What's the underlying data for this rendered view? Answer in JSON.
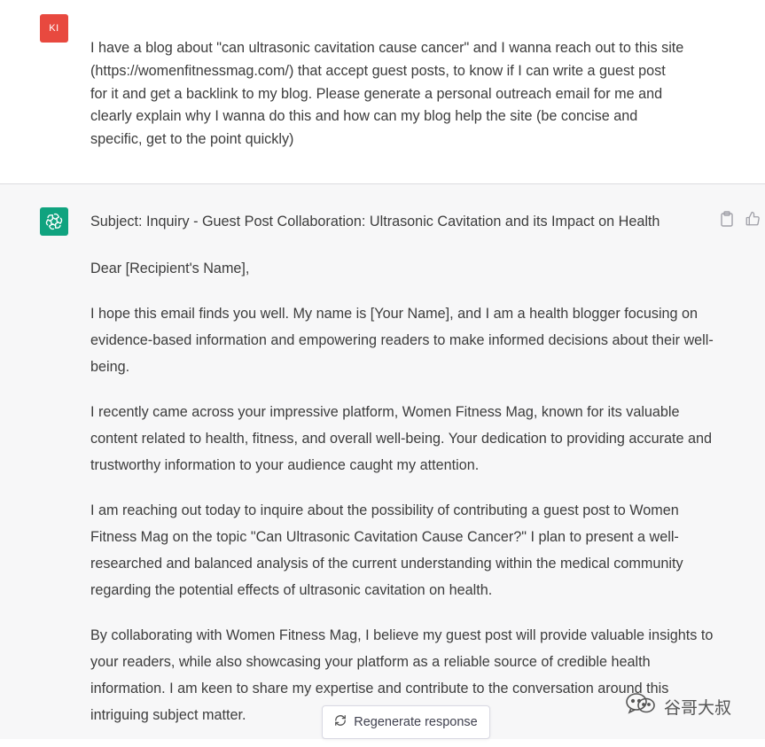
{
  "user": {
    "avatar_initials": "KI",
    "avatar_color": "#e8493f",
    "message": "I have a blog about \"can ultrasonic cavitation cause cancer\" and I wanna reach out to this site\n(https://womenfitnessmag.com/) that accept guest posts, to know if I can write a guest post\nfor it and get a backlink to my blog. Please generate a personal outreach email for me and\nclearly explain  why I wanna do this and how can my blog help the site (be concise and\nspecific, get to the point quickly)"
  },
  "assistant": {
    "avatar_color": "#10a37f",
    "subject": "Subject: Inquiry - Guest Post Collaboration: Ultrasonic Cavitation and its Impact on Health",
    "greeting": "Dear [Recipient's Name],",
    "paragraphs": [
      "I hope this email finds you well. My name is [Your Name], and I am a health blogger focusing on evidence-based information and empowering readers to make informed decisions about their well-being.",
      "I recently came across your impressive platform, Women Fitness Mag, known for its valuable content related to health, fitness, and overall well-being. Your dedication to providing accurate and trustworthy information to your audience caught my attention.",
      "I am reaching out today to inquire about the possibility of contributing a guest post to Women Fitness Mag on the topic \"Can Ultrasonic Cavitation Cause Cancer?\" I plan to present a well-researched and balanced analysis of the current understanding within the medical community regarding the potential effects of ultrasonic cavitation on health.",
      "By collaborating with Women Fitness Mag, I believe my guest post will provide valuable insights to your readers, while also showcasing your platform as a reliable source of credible health information. I am keen to share my expertise and contribute to the conversation around this intriguing subject matter."
    ],
    "icons": [
      "clipboard-icon",
      "thumbs-up-icon"
    ]
  },
  "regenerate": {
    "label": "Regenerate response",
    "icon": "refresh-icon"
  },
  "watermark": {
    "text": "谷哥大叔",
    "icon": "wechat-icon"
  }
}
